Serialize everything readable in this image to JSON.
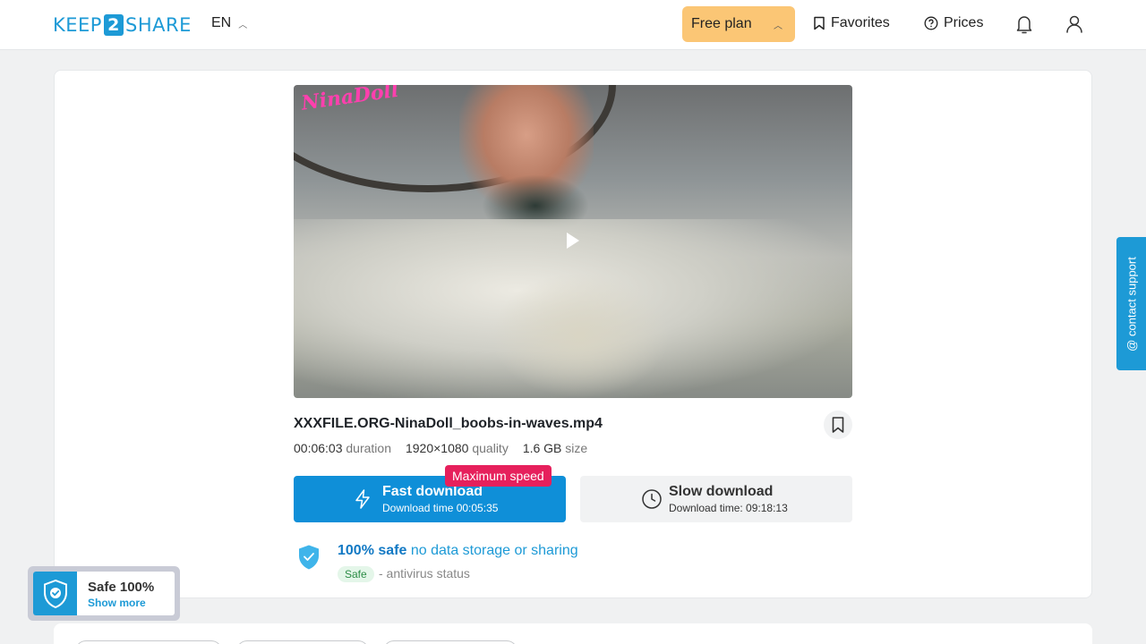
{
  "header": {
    "logo_left": "KEEP",
    "logo_number": "2",
    "logo_right": "SHARE",
    "language": "EN",
    "free_plan": "Free plan",
    "favorites": "Favorites",
    "prices": "Prices"
  },
  "video": {
    "watermark": "NinaDoll"
  },
  "file": {
    "name": "XXXFILE.ORG-NinaDoll_boobs-in-waves.mp4",
    "duration": "00:06:03",
    "duration_label": "duration",
    "quality": "1920×1080",
    "quality_label": "quality",
    "size": "1.6 GB",
    "size_label": "size"
  },
  "download": {
    "max_speed": "Maximum speed",
    "fast_label": "Fast download",
    "fast_time": "Download time 00:05:35",
    "slow_label": "Slow download",
    "slow_time": "Download time: 09:18:13"
  },
  "safety": {
    "title_bold": "100% safe",
    "title_rest": "no data storage or sharing",
    "badge": "Safe",
    "status": "- antivirus status"
  },
  "support": {
    "label": "@ contact support"
  },
  "safe_widget": {
    "title": "Safe 100%",
    "link": "Show more"
  },
  "colors": {
    "brand": "#1d9ad6",
    "fast_button": "#0f8fd8",
    "max_speed_badge": "#e6205c",
    "free_plan": "#fbc675"
  }
}
